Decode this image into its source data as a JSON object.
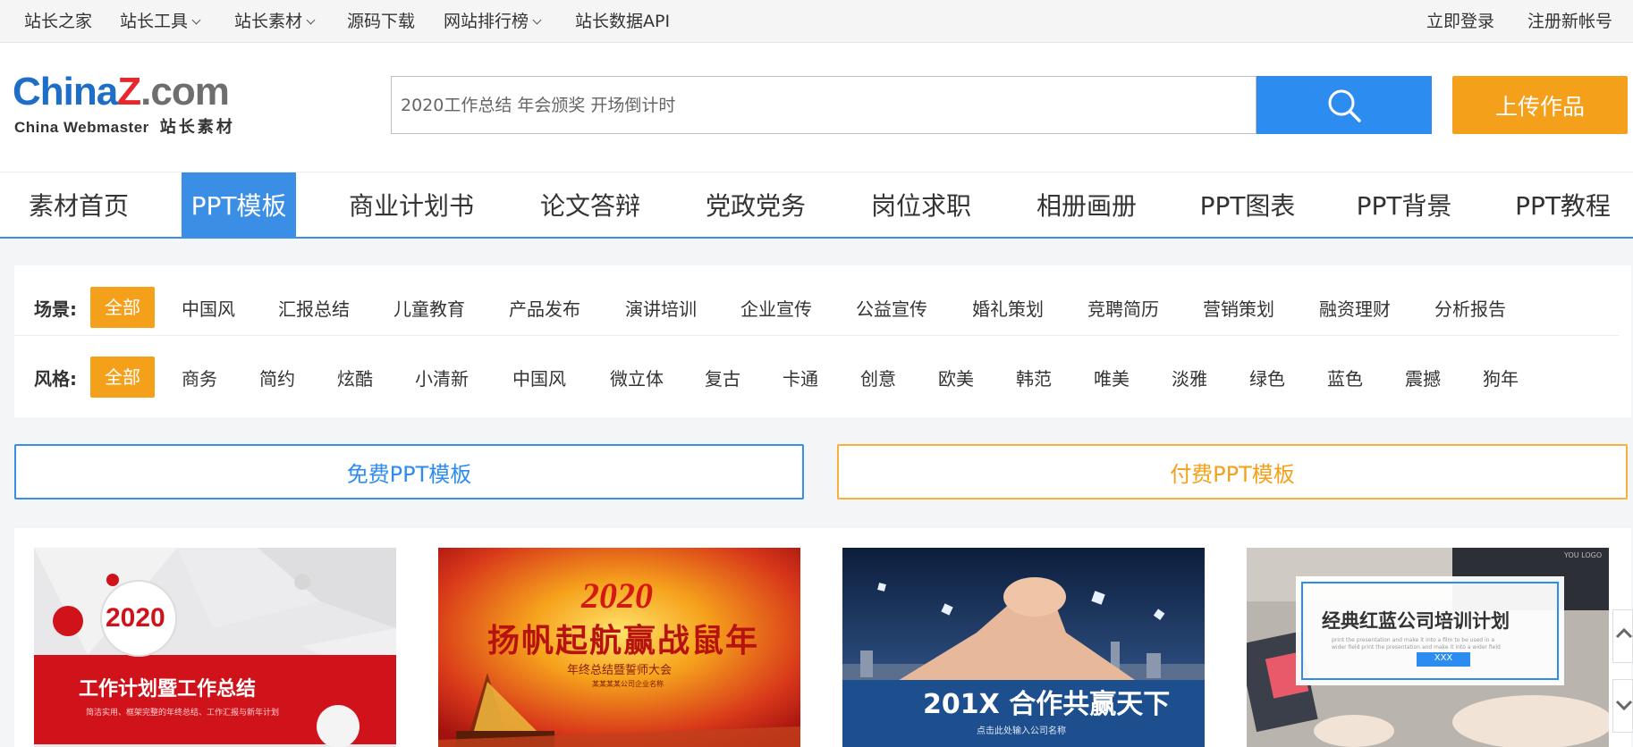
{
  "topbar": {
    "links": [
      {
        "label": "站长之家",
        "dropdown": false
      },
      {
        "label": "站长工具",
        "dropdown": true
      },
      {
        "label": "站长素材",
        "dropdown": true
      },
      {
        "label": "源码下载",
        "dropdown": false
      },
      {
        "label": "网站排行榜",
        "dropdown": true
      },
      {
        "label": "站长数据API",
        "dropdown": false
      }
    ],
    "login": "立即登录",
    "register": "注册新帐号"
  },
  "logo": {
    "main_1": "China",
    "main_2": "Z",
    "main_3": ".com",
    "sub_en": "China Webmaster",
    "sub_cn": "站长素材"
  },
  "search": {
    "placeholder": "2020工作总结 年会颁奖 开场倒计时",
    "icon": "search-icon"
  },
  "upload_button": "上传作品",
  "nav": {
    "items": [
      "素材首页",
      "PPT模板",
      "商业计划书",
      "论文答辩",
      "党政党务",
      "岗位求职",
      "相册画册",
      "PPT图表",
      "PPT背景",
      "PPT教程"
    ],
    "active_index": 1
  },
  "filters": {
    "scene": {
      "label": "场景:",
      "options": [
        "全部",
        "中国风",
        "汇报总结",
        "儿童教育",
        "产品发布",
        "演讲培训",
        "企业宣传",
        "公益宣传",
        "婚礼策划",
        "竞聘简历",
        "营销策划",
        "融资理财",
        "分析报告"
      ],
      "selected": 0
    },
    "style": {
      "label": "风格:",
      "options": [
        "全部",
        "商务",
        "简约",
        "炫酷",
        "小清新",
        "中国风",
        "微立体",
        "复古",
        "卡通",
        "创意",
        "欧美",
        "韩范",
        "唯美",
        "淡雅",
        "绿色",
        "蓝色",
        "震撼",
        "狗年"
      ],
      "selected": 0
    }
  },
  "type_tabs": {
    "free": "免费PPT模板",
    "paid": "付费PPT模板"
  },
  "cards": [
    {
      "badge": "2020",
      "title": "工作计划暨工作总结",
      "subtitle": "简洁实用、框架完整的年终总结、工作汇报与新年计划"
    },
    {
      "year": "2020",
      "title": "扬帆起航赢战鼠年",
      "subtitle": "年终总结暨誓师大会",
      "small": "某某某某公司企业名称"
    },
    {
      "title": "201X 合作共赢天下",
      "subtitle": "点击此处输入公司名称"
    },
    {
      "title": "经典红蓝公司培训计划",
      "desc_1": "print the presentation and make it into a film to be used in a",
      "desc_2": "wider field print the presentation and make it into a wider field",
      "button": "XXX",
      "corner": "YOU LOGO"
    }
  ],
  "colors": {
    "primary_blue": "#2d8cf0",
    "accent_orange": "#f5a01a",
    "nav_blue": "#3a8ee6"
  }
}
